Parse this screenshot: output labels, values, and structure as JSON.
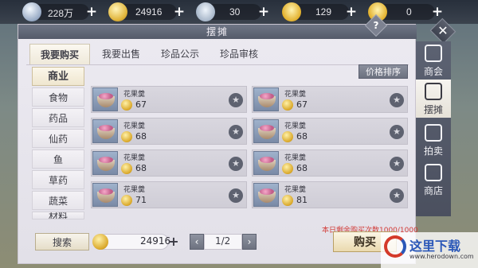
{
  "currencies": [
    {
      "icon": "silver-coin-icon",
      "value": "228万"
    },
    {
      "icon": "gold-coin-icon",
      "value": "24916"
    },
    {
      "icon": "silver-ingot-icon",
      "value": "30"
    },
    {
      "icon": "gold-ingot-icon",
      "value": "129"
    },
    {
      "icon": "gold-ingot-small-icon",
      "value": "0"
    }
  ],
  "panel": {
    "title": "摆摊"
  },
  "tabs": [
    {
      "label": "我要购买",
      "active": true
    },
    {
      "label": "我要出售",
      "active": false
    },
    {
      "label": "珍品公示",
      "active": false
    },
    {
      "label": "珍品审核",
      "active": false
    }
  ],
  "help": {
    "label": "?"
  },
  "categories": {
    "header": "商业",
    "items": [
      "食物",
      "药品",
      "仙药",
      "鱼",
      "草药",
      "蔬菜",
      "材料"
    ]
  },
  "sort": {
    "label": "价格排序"
  },
  "items": [
    {
      "name": "花果羹",
      "price": "67"
    },
    {
      "name": "花果羹",
      "price": "67"
    },
    {
      "name": "花果羹",
      "price": "68"
    },
    {
      "name": "花果羹",
      "price": "68"
    },
    {
      "name": "花果羹",
      "price": "68"
    },
    {
      "name": "花果羹",
      "price": "68"
    },
    {
      "name": "花果羹",
      "price": "71"
    },
    {
      "name": "花果羹",
      "price": "81"
    }
  ],
  "notice": "本日剩余购买次数1000/1000",
  "bottom": {
    "search_label": "搜索",
    "money_value": "24916",
    "page": "1/2",
    "buy_label": "购买"
  },
  "side_menu": [
    {
      "label": "商会",
      "active": false
    },
    {
      "label": "摆摊",
      "active": true
    },
    {
      "label": "拍卖",
      "active": false
    },
    {
      "label": "商店",
      "active": false
    }
  ],
  "watermark": {
    "text": "这里下载",
    "url": "www.herodown.com"
  }
}
